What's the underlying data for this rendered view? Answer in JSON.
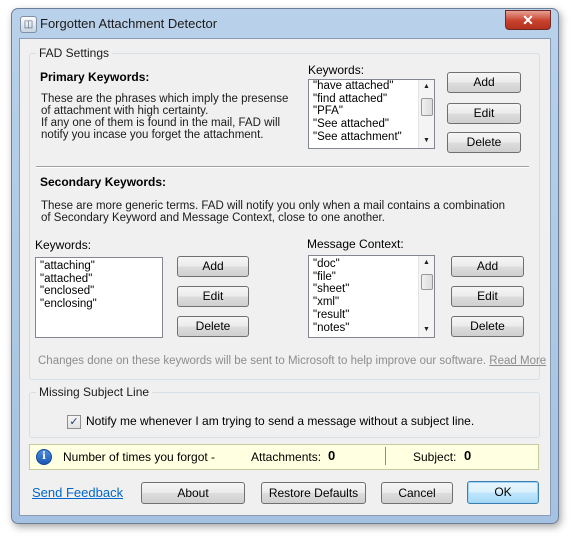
{
  "window": {
    "title": "Forgotten Attachment Detector",
    "close_glyph": "✕",
    "icon_glyph": "◫"
  },
  "fad_settings": {
    "group_label": "FAD Settings",
    "primary": {
      "heading": "Primary Keywords:",
      "desc_lines": [
        "These are the phrases which imply the presense",
        "of attachment with high certainty.",
        "If any one of them is found in the mail, FAD will",
        "notify you incase you forget the attachment."
      ],
      "list_label": "Keywords:",
      "keywords": [
        "\"have attached\"",
        "\"find attached\"",
        "\"PFA\"",
        "\"See attached\"",
        "\"See attachment\""
      ],
      "add": "Add",
      "edit": "Edit",
      "delete": "Delete"
    },
    "secondary": {
      "heading": "Secondary Keywords:",
      "desc_lines": [
        "These are more generic terms. FAD will notify you only when a mail contains a combination",
        "of Secondary Keyword and Message Context, close to one another."
      ],
      "keywords_label": "Keywords:",
      "keywords": [
        "\"attaching\"",
        "\"attached\"",
        "\"enclosed\"",
        "\"enclosing\""
      ],
      "context_label": "Message Context:",
      "contexts": [
        "\"doc\"",
        "\"file\"",
        "\"sheet\"",
        "\"xml\"",
        "\"result\"",
        "\"notes\""
      ],
      "add": "Add",
      "edit": "Edit",
      "delete": "Delete"
    },
    "notice": "Changes done on these keywords will be sent to Microsoft to help improve our software.",
    "read_more": "Read More"
  },
  "missing_subject": {
    "group_label": "Missing Subject Line",
    "checkbox_label": "Notify me whenever I am trying to send a message without a subject line.",
    "checked": true,
    "check_glyph": "✓"
  },
  "stats": {
    "info_glyph": "i",
    "label": "Number of times you forgot -",
    "attachments_label": "Attachments:",
    "attachments_value": "0",
    "subject_label": "Subject:",
    "subject_value": "0"
  },
  "footer": {
    "send_feedback": "Send Feedback",
    "about": "About",
    "restore_defaults": "Restore Defaults",
    "cancel": "Cancel",
    "ok": "OK"
  },
  "scroll_glyphs": {
    "up": "▲",
    "down": "▼"
  }
}
